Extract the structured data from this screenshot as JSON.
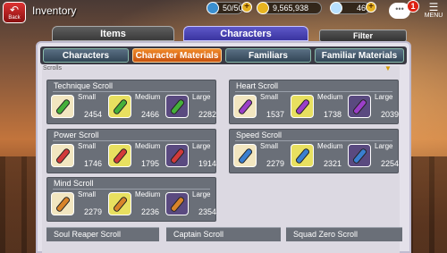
{
  "header": {
    "back_label": "Back",
    "title": "Inventory",
    "stamina": "50/50",
    "coins": "9,565,938",
    "gems": "46",
    "notifications": "1",
    "menu_label": "MENU"
  },
  "main_tabs": {
    "items": "Items",
    "characters": "Characters",
    "filter": "Filter"
  },
  "sub_tabs": [
    "Characters",
    "Character Materials",
    "Familiars",
    "Familiar Materials"
  ],
  "section_header": "Scrolls",
  "groups": [
    {
      "title": "Technique Scroll",
      "color": "#45b03a",
      "items": [
        {
          "size": "Small",
          "qty": "2454"
        },
        {
          "size": "Medium",
          "qty": "2466"
        },
        {
          "size": "Large",
          "qty": "2282"
        }
      ]
    },
    {
      "title": "Heart Scroll",
      "color": "#9b3fc8",
      "items": [
        {
          "size": "Small",
          "qty": "1537"
        },
        {
          "size": "Medium",
          "qty": "1738"
        },
        {
          "size": "Large",
          "qty": "2039"
        }
      ]
    },
    {
      "title": "Power Scroll",
      "color": "#d23a3a",
      "items": [
        {
          "size": "Small",
          "qty": "1746"
        },
        {
          "size": "Medium",
          "qty": "1795"
        },
        {
          "size": "Large",
          "qty": "1914"
        }
      ]
    },
    {
      "title": "Speed Scroll",
      "color": "#3a7fd0",
      "items": [
        {
          "size": "Small",
          "qty": "2279"
        },
        {
          "size": "Medium",
          "qty": "2321"
        },
        {
          "size": "Large",
          "qty": "2254"
        }
      ]
    },
    {
      "title": "Mind Scroll",
      "color": "#d8842a",
      "items": [
        {
          "size": "Small",
          "qty": "2279"
        },
        {
          "size": "Medium",
          "qty": "2236"
        },
        {
          "size": "Large",
          "qty": "2354"
        }
      ]
    }
  ],
  "bottom_groups": [
    "Soul Reaper Scroll",
    "Captain Scroll",
    "Squad Zero Scroll"
  ]
}
